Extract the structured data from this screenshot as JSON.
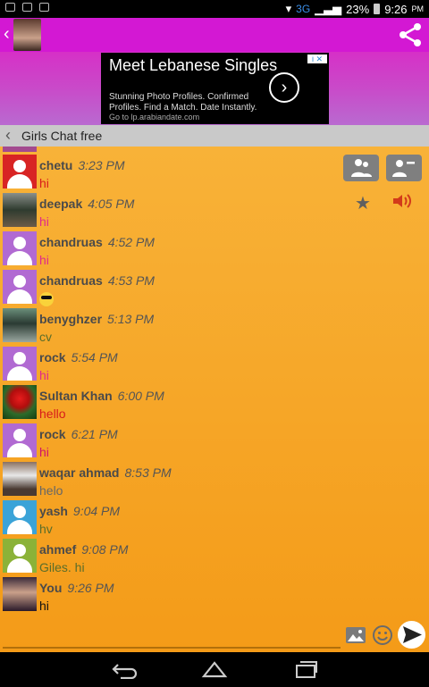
{
  "status_bar": {
    "network": "3G",
    "battery": "23%",
    "time": "9:26",
    "ampm": "PM"
  },
  "app_bar": {
    "back_icon": "chevron-left-icon",
    "share_icon": "share-icon"
  },
  "ad": {
    "headline": "Meet Lebanese Singles",
    "body": "Stunning Photo Profiles. Confirmed Profiles. Find a Match. Date Instantly.",
    "url": "Go to lp.arabiandate.com",
    "cta_icon": "chevron-right-icon"
  },
  "chat_header": {
    "title": "Girls Chat free"
  },
  "messages": [
    {
      "user": "chetu",
      "time": "3:23 PM",
      "text": "hi"
    },
    {
      "user": "deepak",
      "time": "4:05 PM",
      "text": "hi"
    },
    {
      "user": "chandruas",
      "time": "4:52 PM",
      "text": "hi"
    },
    {
      "user": "chandruas",
      "time": "4:53 PM",
      "text": ""
    },
    {
      "user": "benyghzer",
      "time": "5:13 PM",
      "text": "cv"
    },
    {
      "user": "rock",
      "time": "5:54 PM",
      "text": "hi"
    },
    {
      "user": "Sultan Khan",
      "time": "6:00 PM",
      "text": "hello"
    },
    {
      "user": "rock",
      "time": "6:21 PM",
      "text": "hi"
    },
    {
      "user": "waqar ahmad",
      "time": "8:53 PM",
      "text": "helo"
    },
    {
      "user": "yash",
      "time": "9:04 PM",
      "text": "hv"
    },
    {
      "user": "ahmef",
      "time": "9:08 PM",
      "text": "Giles. hi"
    },
    {
      "user": "You",
      "time": "9:26 PM",
      "text": "hi"
    }
  ],
  "colors": {
    "app_bar": "#d318d3",
    "chat_bg_top": "#f8b238",
    "chat_bg_bottom": "#f49b18"
  }
}
